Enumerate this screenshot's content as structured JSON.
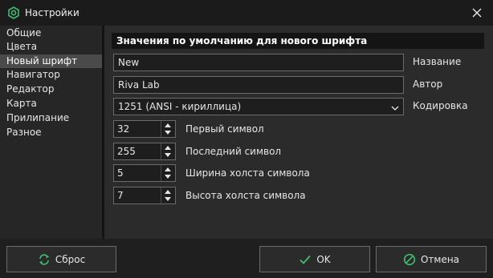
{
  "window": {
    "title": "Настройки"
  },
  "sidebar": {
    "items": [
      {
        "label": "Общие"
      },
      {
        "label": "Цвета"
      },
      {
        "label": "Новый шрифт",
        "selected": true
      },
      {
        "label": "Навигатор"
      },
      {
        "label": "Редактор"
      },
      {
        "label": "Карта"
      },
      {
        "label": "Прилипание"
      },
      {
        "label": "Разное"
      }
    ]
  },
  "main": {
    "header": "Значения по умолчанию для нового шрифта",
    "name": {
      "value": "New",
      "label": "Название"
    },
    "author": {
      "value": "Riva Lab",
      "label": "Автор"
    },
    "encoding": {
      "value": "1251 (ANSI - кириллица)",
      "label": "Кодировка"
    },
    "spinners": [
      {
        "value": "32",
        "label": "Первый символ"
      },
      {
        "value": "255",
        "label": "Последний символ"
      },
      {
        "value": "5",
        "label": "Ширина холста символа"
      },
      {
        "value": "7",
        "label": "Высота холста символа"
      }
    ]
  },
  "buttons": {
    "reset": "Сброс",
    "ok": "OK",
    "cancel": "Отмена"
  },
  "colors": {
    "accent": "#3fbf72",
    "background": "#2b2b2b",
    "sidebar": "#262626"
  }
}
